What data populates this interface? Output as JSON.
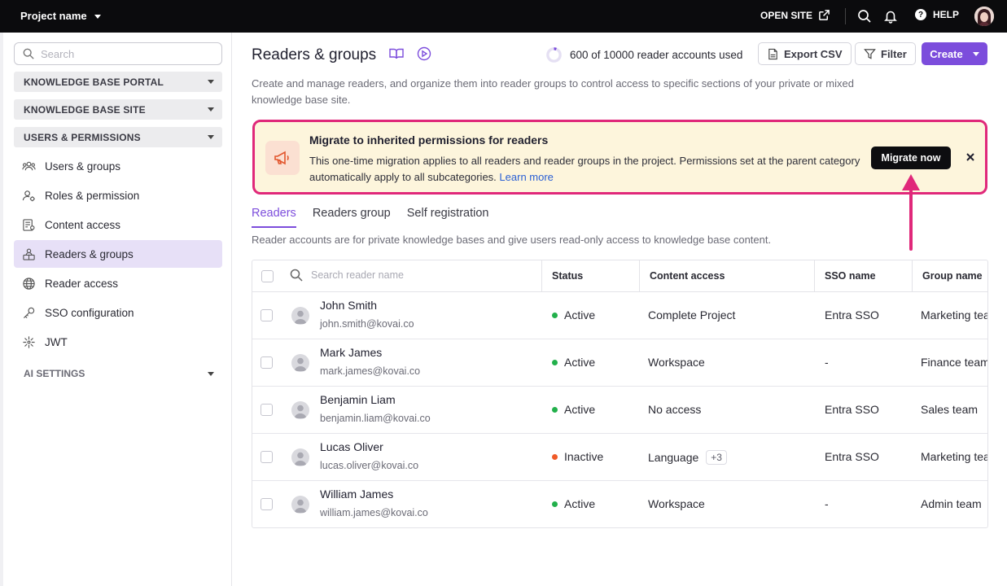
{
  "topbar": {
    "project_label": "Project name",
    "open_site_label": "OPEN SITE",
    "help_label": "HELP"
  },
  "sidebar": {
    "search_placeholder": "Search",
    "sections": [
      {
        "label": "KNOWLEDGE BASE PORTAL"
      },
      {
        "label": "KNOWLEDGE BASE SITE"
      },
      {
        "label": "USERS & PERMISSIONS"
      }
    ],
    "items": [
      {
        "label": "Users & groups",
        "icon": "users-icon"
      },
      {
        "label": "Roles & permission",
        "icon": "user-gear-icon"
      },
      {
        "label": "Content access",
        "icon": "content-access-icon"
      },
      {
        "label": "Readers & groups",
        "icon": "readers-icon",
        "active": true
      },
      {
        "label": "Reader access",
        "icon": "globe-icon"
      },
      {
        "label": "SSO configuration",
        "icon": "key-icon"
      },
      {
        "label": "JWT",
        "icon": "jwt-icon"
      }
    ],
    "ai_settings_label": "AI SETTINGS"
  },
  "header": {
    "title": "Readers & groups",
    "usage_text": "600 of 10000 reader accounts used",
    "usage_fraction": 0.06,
    "export_label": "Export CSV",
    "filter_label": "Filter",
    "create_label": "Create",
    "description": "Create and manage readers, and organize them into reader groups to control access to specific sections of your private or mixed knowledge base site."
  },
  "banner": {
    "title": "Migrate to inherited permissions for readers",
    "text": "This one-time migration applies to all readers and reader groups in the project. Permissions set at the parent category automatically apply to all subcategories.",
    "link_label": "Learn more",
    "button_label": "Migrate now",
    "accent_color": "#e0287a"
  },
  "tabs": [
    {
      "label": "Readers",
      "active": true
    },
    {
      "label": "Readers group",
      "active": false
    },
    {
      "label": "Self registration",
      "active": false
    }
  ],
  "subtitle": "Reader accounts are for private knowledge bases and give users read-only access to knowledge base content.",
  "table": {
    "search_placeholder": "Search reader name",
    "columns": [
      "Status",
      "Content access",
      "SSO name",
      "Group name"
    ],
    "rows": [
      {
        "name": "John Smith",
        "email": "john.smith@kovai.co",
        "status": "Active",
        "status_color": "#22b04b",
        "content": "Complete Project",
        "extra": "",
        "sso": "Entra SSO",
        "group": "Marketing team"
      },
      {
        "name": "Mark James",
        "email": "mark.james@kovai.co",
        "status": "Active",
        "status_color": "#22b04b",
        "content": "Workspace",
        "extra": "",
        "sso": "-",
        "group": "Finance team"
      },
      {
        "name": "Benjamin Liam",
        "email": "benjamin.liam@kovai.co",
        "status": "Active",
        "status_color": "#22b04b",
        "content": "No access",
        "extra": "",
        "sso": "Entra SSO",
        "group": "Sales team"
      },
      {
        "name": "Lucas Oliver",
        "email": "lucas.oliver@kovai.co",
        "status": "Inactive",
        "status_color": "#f05a28",
        "content": "Language",
        "extra": "+3",
        "sso": "Entra SSO",
        "group": "Marketing team"
      },
      {
        "name": "William James",
        "email": "william.james@kovai.co",
        "status": "Active",
        "status_color": "#22b04b",
        "content": "Workspace",
        "extra": "",
        "sso": "-",
        "group": "Admin team"
      }
    ]
  },
  "colors": {
    "brand": "#7c4ddc",
    "topbar": "#0b0b0d",
    "banner_bg": "#fdf5dc"
  }
}
